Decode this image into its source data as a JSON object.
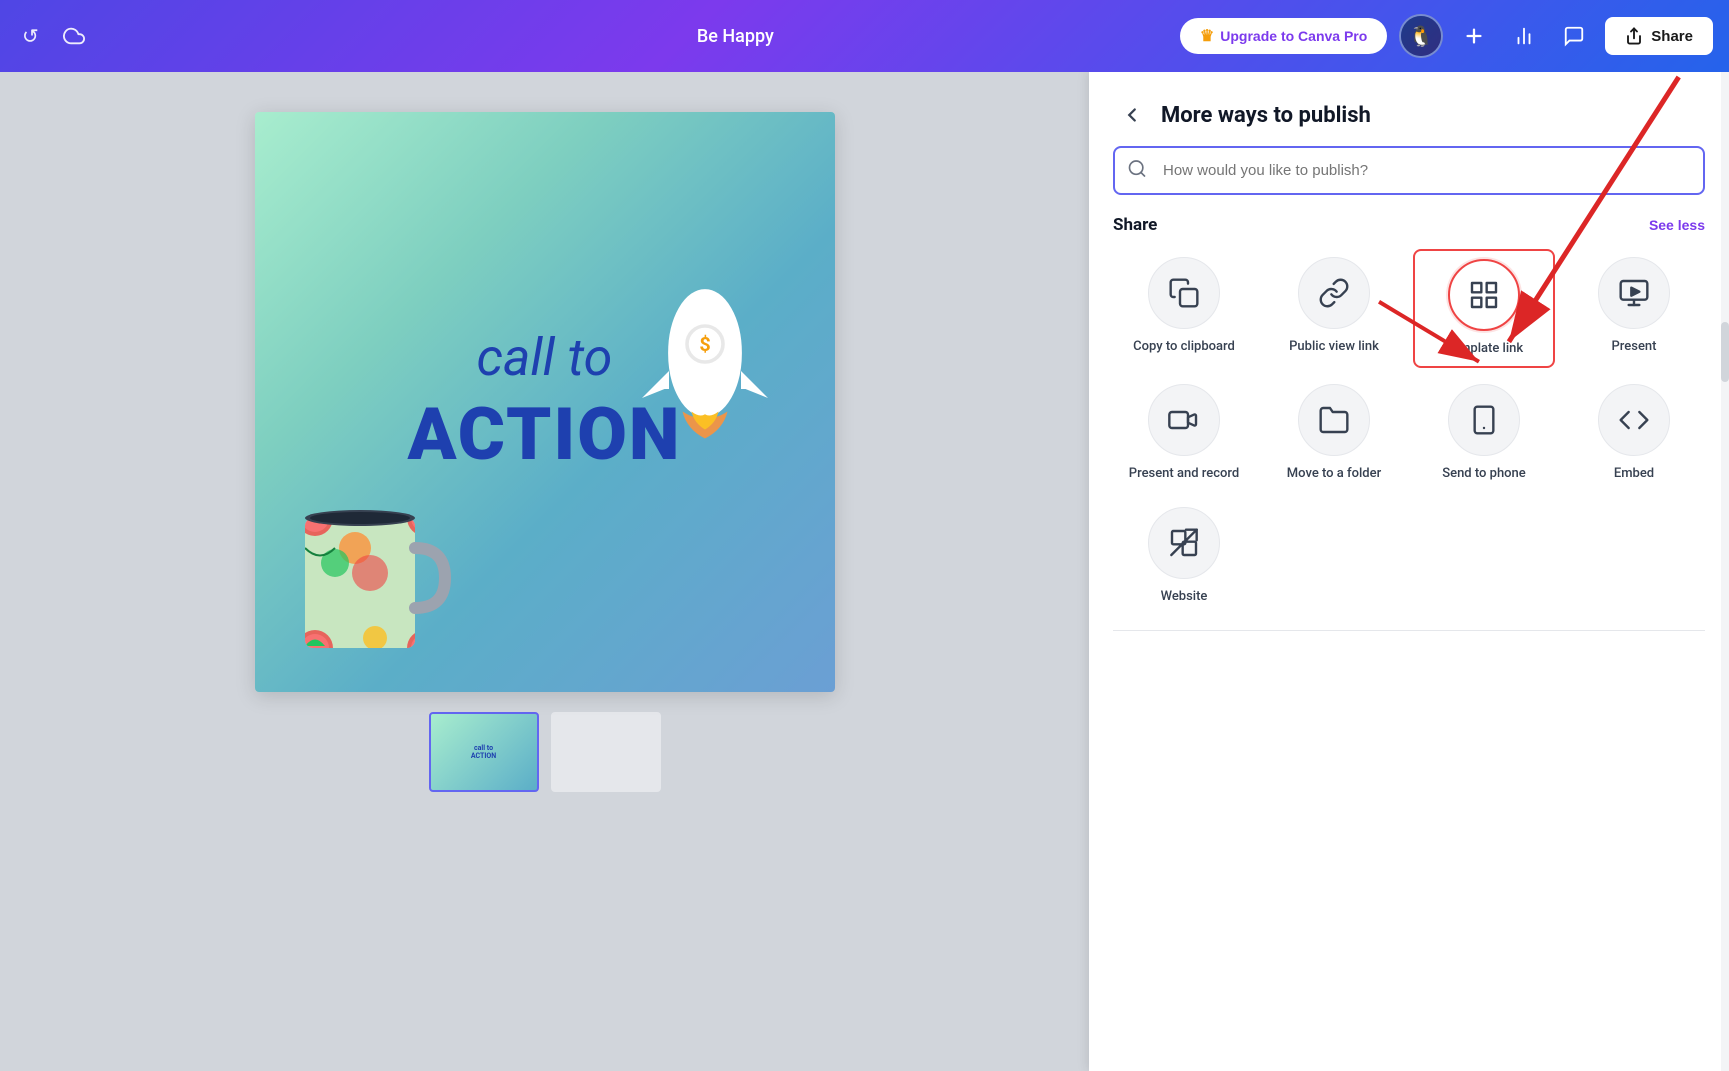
{
  "header": {
    "undo_label": "↺",
    "cloud_label": "☁",
    "title": "Be Happy",
    "upgrade_label": "Upgrade to Canva Pro",
    "crown": "♛",
    "plus_label": "+",
    "analytics_label": "📊",
    "comments_label": "💬",
    "share_label": "Share",
    "share_icon": "⬆"
  },
  "panel": {
    "back_label": "‹",
    "title": "More ways to publish",
    "search_placeholder": "How would you like to publish?",
    "share_section_title": "Share",
    "see_less_label": "See less",
    "options_row1": [
      {
        "id": "copy-clipboard",
        "icon": "⧉",
        "label": "Copy to clipboard",
        "selected": false
      },
      {
        "id": "public-view-link",
        "icon": "🔗",
        "label": "Public view link",
        "selected": false
      },
      {
        "id": "template-link",
        "icon": "⊞",
        "label": "Template link",
        "selected": true
      },
      {
        "id": "present",
        "icon": "▶",
        "label": "Present",
        "selected": false
      }
    ],
    "options_row2": [
      {
        "id": "present-record",
        "icon": "🎬",
        "label": "Present and record",
        "selected": false
      },
      {
        "id": "move-folder",
        "icon": "📁",
        "label": "Move to a folder",
        "selected": false
      },
      {
        "id": "send-phone",
        "icon": "📱",
        "label": "Send to phone",
        "selected": false
      },
      {
        "id": "embed",
        "icon": "</>",
        "label": "Embed",
        "selected": false
      }
    ],
    "options_row3": [
      {
        "id": "website",
        "icon": "🔁",
        "label": "Website",
        "selected": false
      }
    ]
  },
  "design": {
    "text_call": "call to",
    "text_action": "ACTION"
  }
}
